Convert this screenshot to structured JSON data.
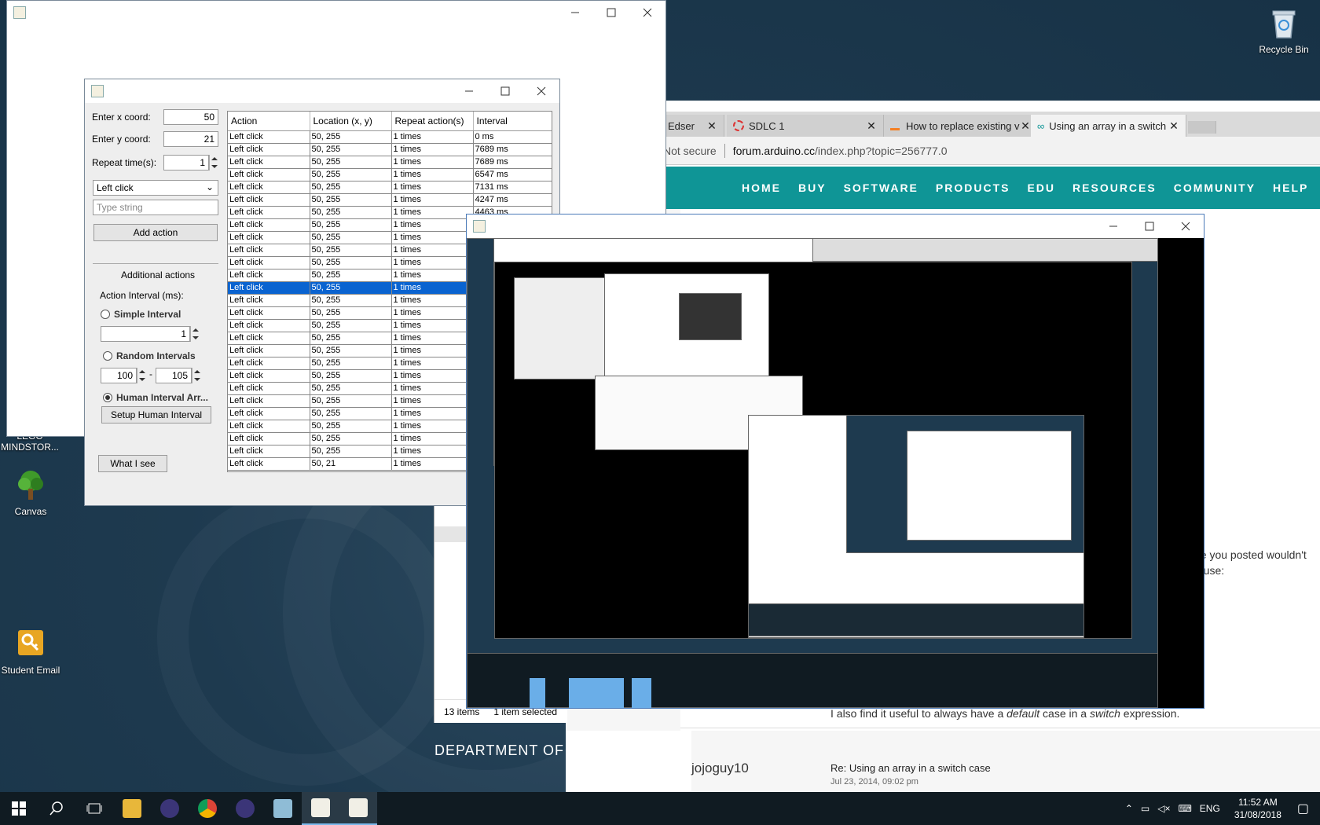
{
  "desktop": {
    "icons": [
      {
        "label": "Recycle Bin"
      },
      {
        "label": "LEGO MINDSTOR..."
      },
      {
        "label": "Canvas"
      },
      {
        "label": "Student Email"
      }
    ],
    "department_text": "DEPARTMENT OF"
  },
  "browser": {
    "tabs": [
      {
        "label": "Edser"
      },
      {
        "label": "SDLC 1"
      },
      {
        "label": "How to replace existing v"
      },
      {
        "label": "Using an array in a switch"
      }
    ],
    "security": "Not secure",
    "url_domain": "forum.arduino.cc",
    "url_path": "/index.php?topic=256777.0",
    "nav": [
      "HOME",
      "BUY",
      "SOFTWARE",
      "PRODUCTS",
      "EDU",
      "RESOURCES",
      "COMMUNITY",
      "HELP"
    ],
    "post_fragment_1": "de you posted wouldn't",
    "post_fragment_2": "d use:",
    "post_line_pre": "I also find it useful to always have a ",
    "post_line_default": "default",
    "post_line_mid": " case in a ",
    "post_line_switch": "switch",
    "post_line_post": " expression.",
    "reply_user": "jojoguy10",
    "reply_subject": "Re: Using an array in a switch case",
    "reply_date": "Jul 23, 2014, 09:02 pm"
  },
  "explorer": {
    "items_count": "13 items",
    "selected": "1 item selected"
  },
  "clicker": {
    "x_label": "Enter x coord:",
    "x_value": "50",
    "y_label": "Enter y coord:",
    "y_value": "21",
    "repeat_label": "Repeat time(s):",
    "repeat_value": "1",
    "action_select": "Left click",
    "type_placeholder": "Type string",
    "add_action": "Add action",
    "additional_actions": "Additional actions",
    "interval_label": "Action Interval (ms):",
    "simple_interval": "Simple Interval",
    "simple_value": "1",
    "random_intervals": "Random Intervals",
    "random_min": "100",
    "random_sep": "-",
    "random_max": "105",
    "human_interval": "Human Interval Arr...",
    "setup_human": "Setup Human Interval",
    "what_i_see": "What I see",
    "table": {
      "headers": [
        "Action",
        "Location (x, y)",
        "Repeat action(s)",
        "Interval"
      ],
      "rows": [
        [
          "Left click",
          "50, 255",
          "1 times",
          "0 ms"
        ],
        [
          "Left click",
          "50, 255",
          "1 times",
          "7689 ms"
        ],
        [
          "Left click",
          "50, 255",
          "1 times",
          "7689 ms"
        ],
        [
          "Left click",
          "50, 255",
          "1 times",
          "6547 ms"
        ],
        [
          "Left click",
          "50, 255",
          "1 times",
          "7131 ms"
        ],
        [
          "Left click",
          "50, 255",
          "1 times",
          "4247 ms"
        ],
        [
          "Left click",
          "50, 255",
          "1 times",
          "4463 ms"
        ],
        [
          "Left click",
          "50, 255",
          "1 times",
          ""
        ],
        [
          "Left click",
          "50, 255",
          "1 times",
          ""
        ],
        [
          "Left click",
          "50, 255",
          "1 times",
          ""
        ],
        [
          "Left click",
          "50, 255",
          "1 times",
          ""
        ],
        [
          "Left click",
          "50, 255",
          "1 times",
          ""
        ],
        [
          "Left click",
          "50, 255",
          "1 times",
          ""
        ],
        [
          "Left click",
          "50, 255",
          "1 times",
          ""
        ],
        [
          "Left click",
          "50, 255",
          "1 times",
          ""
        ],
        [
          "Left click",
          "50, 255",
          "1 times",
          ""
        ],
        [
          "Left click",
          "50, 255",
          "1 times",
          ""
        ],
        [
          "Left click",
          "50, 255",
          "1 times",
          ""
        ],
        [
          "Left click",
          "50, 255",
          "1 times",
          ""
        ],
        [
          "Left click",
          "50, 255",
          "1 times",
          ""
        ],
        [
          "Left click",
          "50, 255",
          "1 times",
          ""
        ],
        [
          "Left click",
          "50, 255",
          "1 times",
          ""
        ],
        [
          "Left click",
          "50, 255",
          "1 times",
          ""
        ],
        [
          "Left click",
          "50, 255",
          "1 times",
          ""
        ],
        [
          "Left click",
          "50, 255",
          "1 times",
          ""
        ],
        [
          "Left click",
          "50, 255",
          "1 times",
          ""
        ],
        [
          "Left click",
          "50, 21",
          "1 times",
          ""
        ]
      ],
      "selected_row": 12
    }
  },
  "taskbar": {
    "language": "ENG",
    "time": "11:52 AM",
    "date": "31/08/2018"
  },
  "colors": {
    "arduino_teal": "#0f9596",
    "selection_blue": "#0a63d0",
    "taskbar": "#101b22"
  }
}
